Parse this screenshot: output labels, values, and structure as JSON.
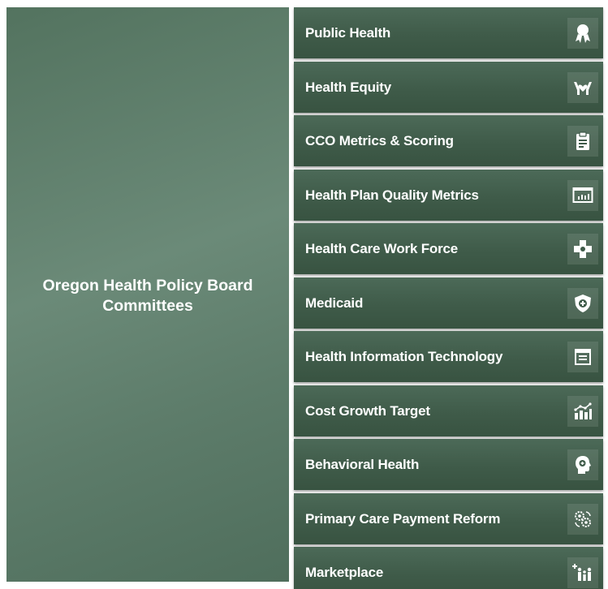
{
  "board": {
    "title": "Oregon Health Policy Board\nCommittees"
  },
  "committees": [
    {
      "label": "Public Health",
      "icon": "award-ribbon-icon"
    },
    {
      "label": "Health Equity",
      "icon": "hands-heart-icon"
    },
    {
      "label": "CCO Metrics & Scoring",
      "icon": "clipboard-icon"
    },
    {
      "label": "Health Plan Quality Metrics",
      "icon": "monitor-chart-icon"
    },
    {
      "label": "Health Care Work Force",
      "icon": "medical-cross-icon"
    },
    {
      "label": "Medicaid",
      "icon": "shield-plus-icon"
    },
    {
      "label": "Health Information Technology",
      "icon": "document-list-icon"
    },
    {
      "label": "Cost Growth Target",
      "icon": "bar-chart-trend-icon"
    },
    {
      "label": "Behavioral Health",
      "icon": "head-profile-icon"
    },
    {
      "label": "Primary Care Payment Reform",
      "icon": "gears-icon"
    },
    {
      "label": "Marketplace",
      "icon": "family-icon"
    }
  ],
  "colors": {
    "panel": "#5d7c6a",
    "tile": "#3f5b49",
    "text": "#ffffff"
  }
}
